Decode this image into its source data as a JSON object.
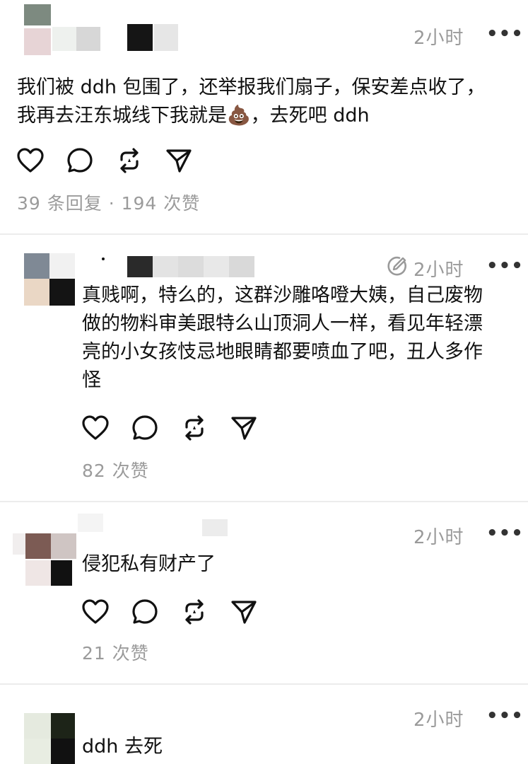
{
  "posts": [
    {
      "time": "2小时",
      "more": "•••",
      "text": "我们被 ddh 包围了，还举报我们扇子，保安差点收了，\n我再去汪东城线下我就是💩，去死吧 ddh",
      "stats": "39 条回复 · 194 次赞",
      "icons": [
        "heart-icon",
        "comment-icon",
        "repost-icon",
        "share-icon"
      ]
    },
    {
      "time": "2小时",
      "more": "•••",
      "edited": true,
      "text": "真贱啊，特么的，这群沙雕咯噔大姨，自己废物\n做的物料审美跟特么山顶洞人一样，看见年轻漂\n亮的小女孩忮忌地眼睛都要喷血了吧，丑人多作\n怪",
      "stats": "82 次赞"
    },
    {
      "time": "2小时",
      "more": "•••",
      "text": "侵犯私有财产了",
      "stats": "21 次赞"
    },
    {
      "time": "2小时",
      "more": "•••",
      "text": "ddh 去死"
    }
  ]
}
